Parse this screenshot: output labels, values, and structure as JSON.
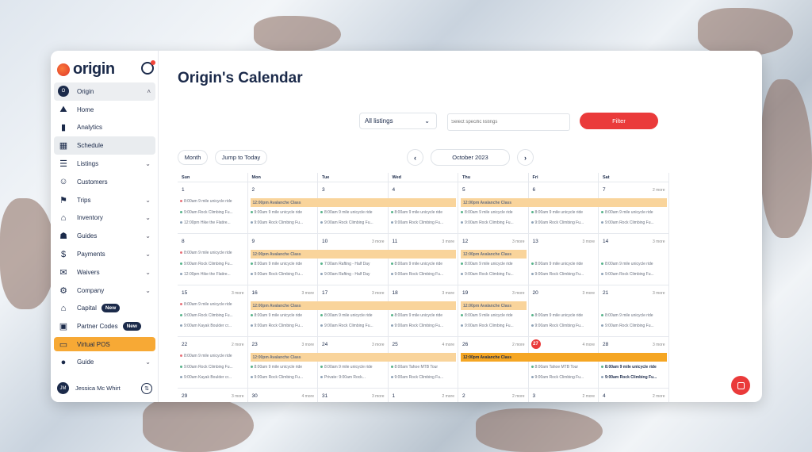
{
  "app": {
    "brand": "origin"
  },
  "sidebar": {
    "org": {
      "initial": "O",
      "label": "Origin"
    },
    "items": [
      {
        "label": "Home",
        "icon": "mountain-icon",
        "chev": false
      },
      {
        "label": "Analytics",
        "icon": "bar-chart-icon",
        "chev": false
      },
      {
        "label": "Schedule",
        "icon": "calendar-icon",
        "chev": false
      },
      {
        "label": "Listings",
        "icon": "list-icon",
        "chev": true
      },
      {
        "label": "Customers",
        "icon": "people-icon",
        "chev": false
      },
      {
        "label": "Trips",
        "icon": "map-signpost-icon",
        "chev": true
      },
      {
        "label": "Inventory",
        "icon": "warehouse-icon",
        "chev": true
      },
      {
        "label": "Guides",
        "icon": "person-badge-icon",
        "chev": true
      },
      {
        "label": "Payments",
        "icon": "money-icon",
        "chev": true
      },
      {
        "label": "Waivers",
        "icon": "document-icon",
        "chev": true
      },
      {
        "label": "Company",
        "icon": "gear-icon",
        "chev": true
      },
      {
        "label": "Capital",
        "icon": "bank-icon",
        "badge": "New"
      },
      {
        "label": "Partner Codes",
        "icon": "id-card-icon",
        "badge": "New"
      },
      {
        "label": "Virtual POS",
        "icon": "pos-icon"
      },
      {
        "label": "Guide",
        "icon": "guide-icon",
        "chev": true
      }
    ],
    "user": {
      "initials": "JM",
      "name": "Jessica Mc Whirt"
    }
  },
  "header": {
    "title": "Origin's Calendar"
  },
  "filters": {
    "listings": "All listings",
    "placeholder": "Select specific listings",
    "button": "Filter"
  },
  "calnav": {
    "month": "Month",
    "today": "Jump to Today",
    "current": "October 2023",
    "prev": "‹",
    "next": "›"
  },
  "calendar": {
    "days": [
      "Sun",
      "Mon",
      "Tue",
      "Wed",
      "Thu",
      "Fri",
      "Sat"
    ],
    "weeks": [
      {
        "nums": [
          "1",
          "2",
          "3",
          "4",
          "5",
          "6",
          "7"
        ],
        "more": [
          "",
          "",
          "",
          "",
          "",
          "",
          "2 more"
        ],
        "bar": {
          "label": "12:00pm Avalanche Class"
        },
        "bar2": {
          "label": "12:00pm Avalanche Class"
        },
        "events": [
          [
            "8:00am 9 mile unicycle ride",
            "9:00am Rock Climbing Fu...",
            "12:00pm Hike the Flatire..."
          ],
          [
            "",
            "9:00am 9 mile unicycle ride",
            "9:00am Rock Climbing Fu..."
          ],
          [
            "",
            "8:00am 9 mile unicycle ride",
            "9:00am Rock Climbing Fu..."
          ],
          [
            "",
            "8:00am 9 mile unicycle ride",
            "9:00am Rock Climbing Fu..."
          ],
          [
            "",
            "8:00am 9 mile unicycle ride",
            "9:00am Rock Climbing Fu..."
          ],
          [
            "",
            "8:00am 9 mile unicycle ride",
            "9:00am Rock Climbing Fu..."
          ],
          [
            "",
            "8:00am 9 mile unicycle ride",
            "9:00am Rock Climbing Fu..."
          ]
        ]
      },
      {
        "nums": [
          "8",
          "9",
          "10",
          "11",
          "12",
          "13",
          "14"
        ],
        "more": [
          "",
          "",
          "3 more",
          "3 more",
          "3 more",
          "3 more",
          "3 more"
        ],
        "bar": {
          "label": "12:00pm Avalanche Class"
        },
        "bar2": {
          "label": "12:00pm Avalanche Class"
        },
        "events": [
          [
            "8:00am 9 mile unicycle ride",
            "9:00am Rock Climbing Fu...",
            "12:00pm Hike the Flatire..."
          ],
          [
            "",
            "8:00am 9 mile unicycle ride",
            "9:00am Rock Climbing Fu..."
          ],
          [
            "",
            "7:00am Rafting - Half Day",
            "9:00am Rafting - Half Day"
          ],
          [
            "",
            "8:00am 9 mile unicycle ride",
            "9:00am Rock Climbing Fu..."
          ],
          [
            "",
            "8:00am 9 mile unicycle ride",
            "9:00am Rock Climbing Fu..."
          ],
          [
            "",
            "8:00am 9 mile unicycle ride",
            "9:00am Rock Climbing Fu..."
          ],
          [
            "",
            "8:00am 9 mile unicycle ride",
            "9:00am Rock Climbing Fu..."
          ]
        ]
      },
      {
        "nums": [
          "15",
          "16",
          "17",
          "18",
          "19",
          "20",
          "21"
        ],
        "more": [
          "3 more",
          "3 more",
          "3 more",
          "3 more",
          "3 more",
          "3 more",
          "3 more"
        ],
        "bar": {
          "label": "12:00pm Avalanche Class"
        },
        "bar2": {
          "label": "12:00pm Avalanche Class"
        },
        "events": [
          [
            "8:00am 9 mile unicycle ride",
            "9:00am Rock Climbing Fu...",
            "9:00am Kayak Boulder cr..."
          ],
          [
            "",
            "8:00am 9 mile unicycle ride",
            "9:00am Rock Climbing Fu..."
          ],
          [
            "",
            "8:00am 9 mile unicycle ride",
            "9:00am Rock Climbing Fu..."
          ],
          [
            "",
            "8:00am 9 mile unicycle ride",
            "9:00am Rock Climbing Fu..."
          ],
          [
            "",
            "8:00am 9 mile unicycle ride",
            "9:00am Rock Climbing Fu..."
          ],
          [
            "",
            "8:00am 9 mile unicycle ride",
            "9:00am Rock Climbing Fu..."
          ],
          [
            "",
            "8:00am 9 mile unicycle ride",
            "9:00am Rock Climbing Fu..."
          ]
        ]
      },
      {
        "nums": [
          "22",
          "23",
          "24",
          "25",
          "26",
          "27",
          "28"
        ],
        "more": [
          "2 more",
          "3 more",
          "3 more",
          "4 more",
          "2 more",
          "4 more",
          "3 more"
        ],
        "bar": {
          "label": "12:00pm Avalanche Class"
        },
        "bar2": {
          "label": "12:00pm Avalanche Class"
        },
        "events": [
          [
            "8:00am 9 mile unicycle ride",
            "9:00am Rock Climbing Fu...",
            "9:00am Kayak Boulder cr..."
          ],
          [
            "",
            "8:00am 9 mile unicycle ride",
            "9:00am Rock Climbing Fu..."
          ],
          [
            "",
            "8:00am 9 mile unicycle ride",
            "Private: 9:00am Rock..."
          ],
          [
            "",
            "8:00am Tahoe MTB Tour",
            "9:00am Rock Climbing Fu..."
          ],
          [
            "",
            "",
            ""
          ],
          [
            "",
            "8:00am Tahoe MTB Tour",
            "9:00am Rock Climbing Fu..."
          ],
          [
            "",
            "8:00am 9 mile unicycle ride",
            "9:00am Rock Climbing Fu..."
          ]
        ]
      },
      {
        "nums": [
          "29",
          "30",
          "31",
          "1",
          "2",
          "3",
          "4"
        ],
        "more": [
          "3 more",
          "4 more",
          "3 more",
          "2 more",
          "2 more",
          "2 more",
          "2 more"
        ]
      }
    ]
  },
  "colors": {
    "accent": "#ea3a3a",
    "navy": "#1b2a4a",
    "bar": "#f9d49b",
    "bar_strong": "#f5a623"
  }
}
